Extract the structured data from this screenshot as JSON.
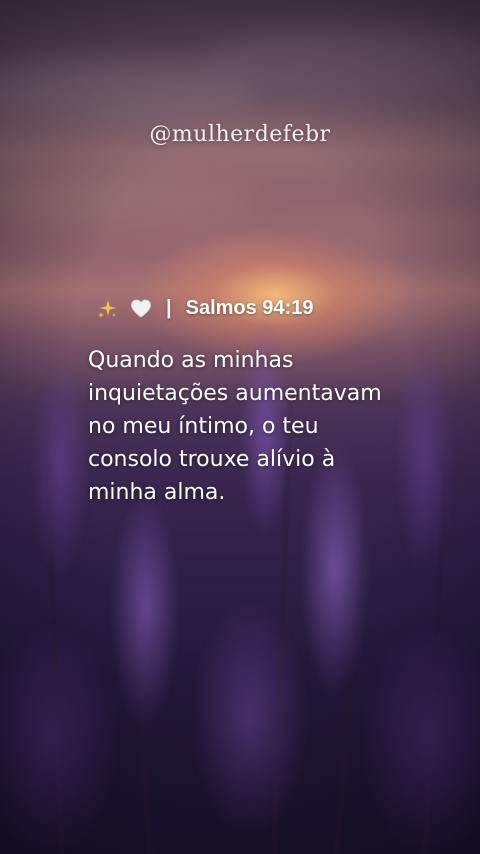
{
  "handle": "@mulherdefebr",
  "reference": {
    "sparkle_icon": "sparkles-emoji",
    "heart_icon": "white-heart-emoji",
    "separator": "|",
    "citation": "Salmos 94:19"
  },
  "verse": {
    "text": "Quando as minhas inquietações aumentavam no meu íntimo, o teu consolo trouxe alívio à minha alma."
  },
  "colors": {
    "text": "#ffffff",
    "sparkle": "#f5c542",
    "heart": "#f2f2f2"
  }
}
